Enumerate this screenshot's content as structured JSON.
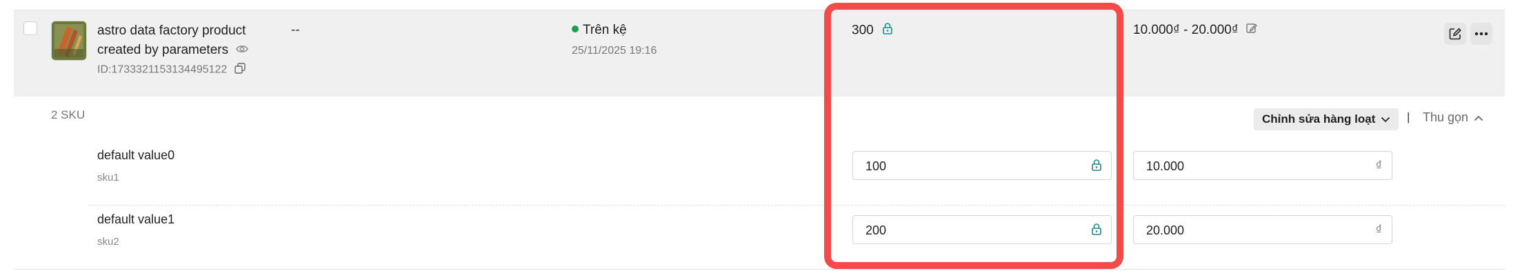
{
  "product": {
    "name": "astro data factory product created by parameters",
    "id_text": "ID:1733321153134495122",
    "category": "--",
    "status_text": "Trên kệ",
    "status_color": "#1e9d52",
    "date": "25/11/2025 19:16",
    "stock": "300",
    "price_range": "10.000₫ - 20.000₫"
  },
  "sku_section": {
    "count_label": "2 SKU",
    "bulk_edit_label": "Chỉnh sửa hàng loạt",
    "separator": "|",
    "collapse_label": "Thu gọn"
  },
  "skus": [
    {
      "name": "default value0",
      "code": "sku1",
      "stock": "100",
      "price": "10.000",
      "currency": "₫"
    },
    {
      "name": "default value1",
      "code": "sku2",
      "stock": "200",
      "price": "20.000",
      "currency": "₫"
    }
  ],
  "colors": {
    "highlight": "#f44a4a",
    "lock_teal": "#1a8c8c",
    "row_bg": "#f0f0f0"
  }
}
